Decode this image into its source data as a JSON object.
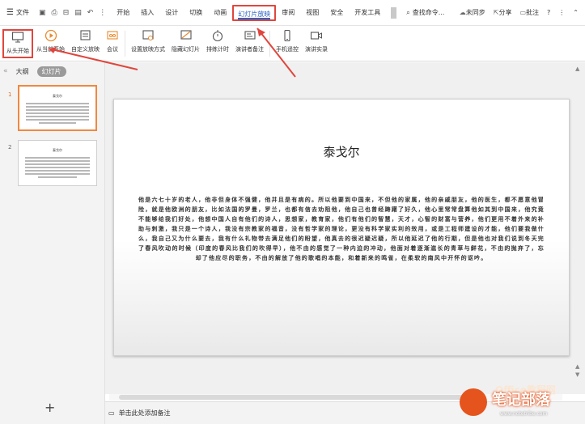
{
  "menubar": {
    "file_label": "文件",
    "tabs": [
      "开始",
      "插入",
      "设计",
      "切换",
      "动画",
      "幻灯片放映",
      "审阅",
      "视图",
      "安全",
      "开发工具"
    ],
    "active_tab": "幻灯片放映",
    "search_label": "查找命令...",
    "sync_label": "未同步",
    "share_label": "分享",
    "comment_label": "批注",
    "help_label": "?"
  },
  "ribbon": {
    "from_start": "从头开始",
    "from_current": "从当前开始",
    "custom_show": "自定义放映",
    "meeting": "会议",
    "setup_show": "设置放映方式",
    "hide_slide": "隐藏幻灯片",
    "rehearse": "排练计时",
    "presenter_notes": "演讲者备注",
    "phone_remote": "手机遥控",
    "record": "演讲实录"
  },
  "left_panel": {
    "tab_outline": "大纲",
    "tab_slides": "幻灯片",
    "slide_numbers": [
      "1",
      "2"
    ]
  },
  "slide": {
    "title": "泰戈尔",
    "body": "他是六七十岁的老人，他非但身体不强健，他并且是有病的。所以他要到中国来，不但他的家属，他的亲戚朋友，他的医生，都不愿意他冒险，就是他欧洲的朋友，比如法国的罗曼，罗兰，也都有信去劝阻他，他自己也曾经踌躇了好久，他心里常常盘算他如其到中国来，他究竟不能够给我们好处，他想中国人自有他们的诗人，思想家，教育家，他们有他们的智慧，天才，心智的财富与营养，他们更用不着外来的补助与刺激，我只是一个诗人，我没有宗教家的福音，没有哲学家的理论，更没有科学家实利的效用，或是工程师建设的才能，他们要我做什么，我自己又为什么要去，我有什么礼物带去满足他们的盼望，他真去的很迟疑迟疑，所以他延迟了他的行期，但是他也对我们说到冬天完了春风吹动的时候（印度的春风比我们的吹得早），他不由的感觉了一种内迫的冲动，他面对着逐渐滋长的青草与鲜花，不由的抛弃了，忘却了他应尽的职务，不由的解放了他的歌唱的本能，和着新来的鸣雀，在柔软的南风中开怀的讴吟。"
  },
  "notes": {
    "placeholder": "单击此处添加备注"
  },
  "add_slide": "+",
  "watermark": {
    "brand": "笔记部落",
    "office": "Office教程网",
    "url": "www.notetribe.com"
  },
  "colors": {
    "highlight": "#e0463d",
    "accent_blue": "#2b64c6",
    "selected_thumb": "#f0883f",
    "brand_orange": "#e6541d"
  }
}
